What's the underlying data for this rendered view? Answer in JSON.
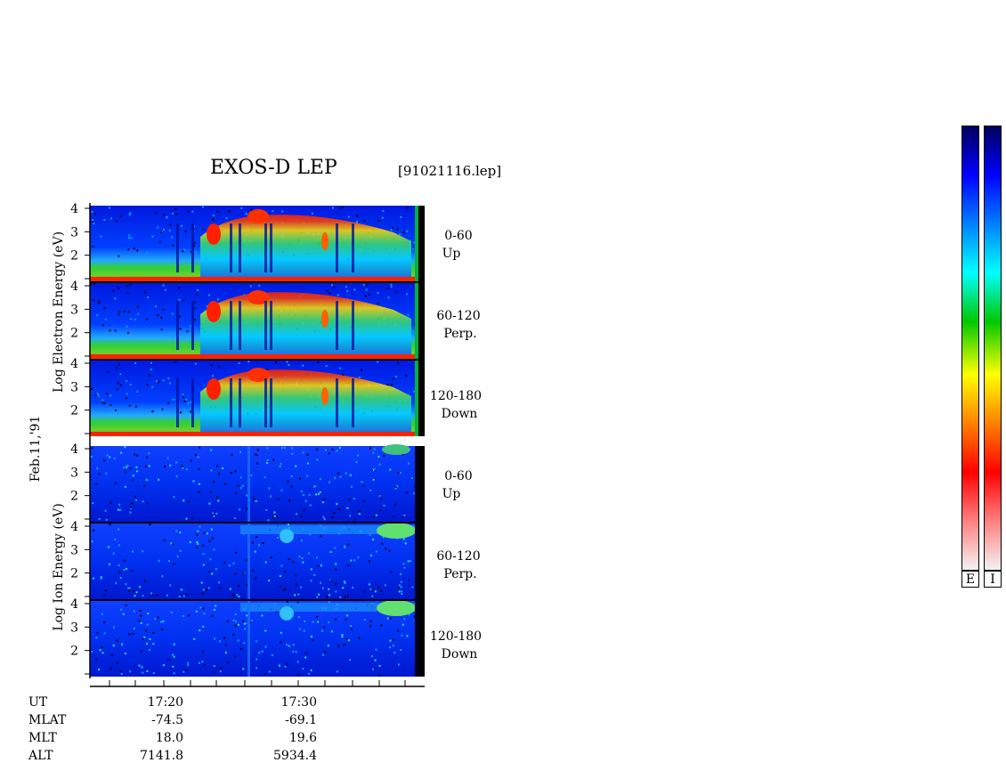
{
  "header": {
    "title": "EXOS-D LEP",
    "file": "[91021116.lep]"
  },
  "date": "Feb.11,'91",
  "electron": {
    "ylabel": "Log Electron Energy (eV)",
    "panels": [
      {
        "angle": "0-60",
        "dir": "Up"
      },
      {
        "angle": "60-120",
        "dir": "Perp."
      },
      {
        "angle": "120-180",
        "dir": "Down"
      }
    ]
  },
  "ion": {
    "ylabel": "Log Ion Energy (eV)",
    "panels": [
      {
        "angle": "0-60",
        "dir": "Up"
      },
      {
        "angle": "60-120",
        "dir": "Perp."
      },
      {
        "angle": "120-180",
        "dir": "Down"
      }
    ]
  },
  "chart_data": {
    "type": "heatmap",
    "title": "EXOS-D LEP",
    "y_ticks": [
      "4",
      "3",
      "2"
    ],
    "x_tick_labels": [
      "17:20",
      "17:30"
    ],
    "ylim": [
      1,
      4
    ]
  },
  "footer": {
    "rows": [
      {
        "label": "UT",
        "values": [
          "17:20",
          "17:30"
        ]
      },
      {
        "label": "MLAT",
        "values": [
          "-74.5",
          "-69.1"
        ]
      },
      {
        "label": "MLT",
        "values": [
          "18.0",
          "19.6"
        ]
      },
      {
        "label": "ALT",
        "values": [
          "7141.8",
          "5934.4"
        ]
      }
    ]
  },
  "colorbars": {
    "labels": [
      "E",
      "I"
    ],
    "colors": [
      "#f2f2f2",
      "#ff8080",
      "#ff0000",
      "#ff8000",
      "#ffff00",
      "#00c800",
      "#00ffff",
      "#0080ff",
      "#0000ff",
      "#000060"
    ]
  }
}
